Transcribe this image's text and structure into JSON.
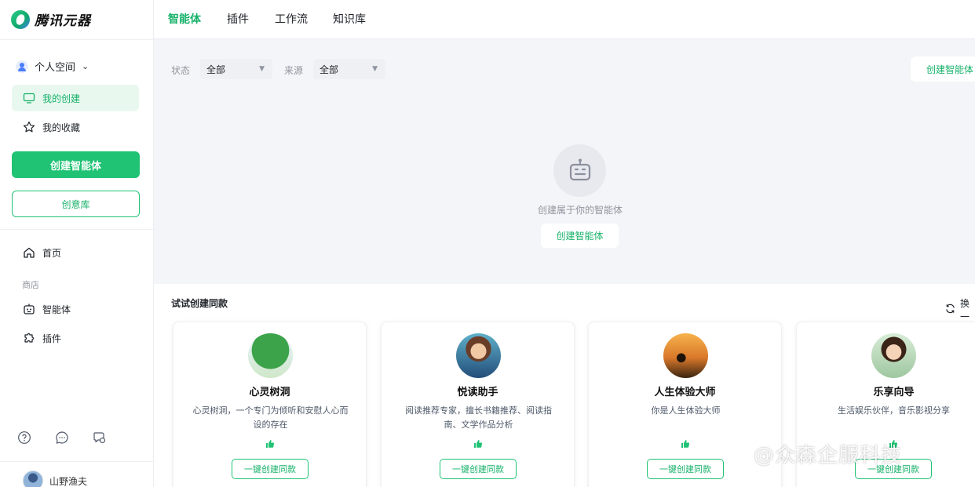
{
  "brand": {
    "name": "腾讯元器"
  },
  "sidebar": {
    "space_label": "个人空间",
    "items_top": [
      {
        "label": "我的创建",
        "icon": "monitor-icon",
        "active": true
      },
      {
        "label": "我的收藏",
        "icon": "star-icon",
        "active": false
      }
    ],
    "create_button": "创建智能体",
    "inspiration_button": "创意库",
    "home_label": "首页",
    "store_section": "商店",
    "store_items": [
      {
        "label": "智能体",
        "icon": "robot-icon"
      },
      {
        "label": "插件",
        "icon": "puzzle-icon"
      }
    ],
    "bottom_icons": [
      "help-icon",
      "chat-icon",
      "feedback-icon"
    ],
    "user_name": "山野渔夫"
  },
  "topnav": {
    "tabs": [
      {
        "label": "智能体",
        "active": true
      },
      {
        "label": "插件",
        "active": false
      },
      {
        "label": "工作流",
        "active": false
      },
      {
        "label": "知识库",
        "active": false
      }
    ]
  },
  "filters": {
    "status_label": "状态",
    "status_value": "全部",
    "source_label": "来源",
    "source_value": "全部",
    "create_button": "创建智能体"
  },
  "empty_state": {
    "text": "创建属于你的智能体",
    "button": "创建智能体"
  },
  "try_section": {
    "title": "试试创建同款",
    "refresh_label": "换一",
    "cards": [
      {
        "name": "心灵树洞",
        "desc": "心灵树洞，一个专门为倾听和安慰人心而设的存在",
        "button": "一键创建同款",
        "avatar": "tree-avatar"
      },
      {
        "name": "悦读助手",
        "desc": "阅读推荐专家，擅长书籍推荐、阅读指南、文学作品分析",
        "button": "一键创建同款",
        "avatar": "reader-avatar"
      },
      {
        "name": "人生体验大师",
        "desc": "你是人生体验大师",
        "button": "一键创建同款",
        "avatar": "sunset-avatar"
      },
      {
        "name": "乐享向导",
        "desc": "生活娱乐伙伴，音乐影视分享",
        "button": "一键创建同款",
        "avatar": "music-avatar"
      }
    ]
  },
  "watermark": "@众森企服科技",
  "colors": {
    "accent": "#20c274",
    "accent_text": "#17b26a",
    "active_bg": "#e9f8ef"
  }
}
